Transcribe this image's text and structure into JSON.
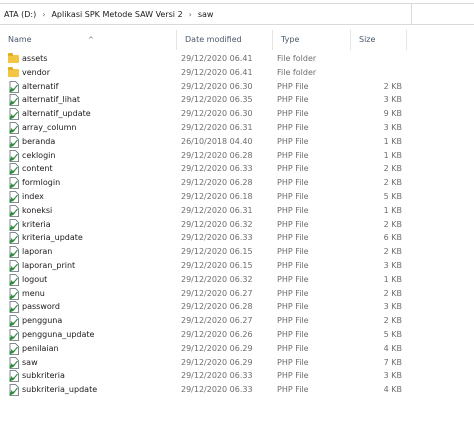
{
  "address": {
    "crumbs": [
      "ATA (D:)",
      "Aplikasi SPK Metode SAW Versi 2",
      "saw"
    ],
    "separator": "›"
  },
  "columns": {
    "name": "Name",
    "date": "Date modified",
    "type": "Type",
    "size": "Size",
    "sort_indicator": "^"
  },
  "colors": {
    "folder": "#f4c542",
    "php_icon_page": "#ffffff",
    "php_icon_accent": "#2e8b3d",
    "header_text": "#4a5a6a"
  },
  "files": [
    {
      "name": "assets",
      "date": "29/12/2020 06.41",
      "type": "File folder",
      "size": "",
      "icon": "folder-icon"
    },
    {
      "name": "vendor",
      "date": "29/12/2020 06.41",
      "type": "File folder",
      "size": "",
      "icon": "folder-icon"
    },
    {
      "name": "alternatif",
      "date": "29/12/2020 06.30",
      "type": "PHP File",
      "size": "2 KB",
      "icon": "php-file-icon"
    },
    {
      "name": "alternatif_lihat",
      "date": "29/12/2020 06.35",
      "type": "PHP File",
      "size": "3 KB",
      "icon": "php-file-icon"
    },
    {
      "name": "alternatif_update",
      "date": "29/12/2020 06.30",
      "type": "PHP File",
      "size": "9 KB",
      "icon": "php-file-icon"
    },
    {
      "name": "array_column",
      "date": "29/12/2020 06.31",
      "type": "PHP File",
      "size": "3 KB",
      "icon": "php-file-icon"
    },
    {
      "name": "beranda",
      "date": "26/10/2018 04.40",
      "type": "PHP File",
      "size": "1 KB",
      "icon": "php-file-icon"
    },
    {
      "name": "ceklogin",
      "date": "29/12/2020 06.28",
      "type": "PHP File",
      "size": "1 KB",
      "icon": "php-file-icon"
    },
    {
      "name": "content",
      "date": "29/12/2020 06.33",
      "type": "PHP File",
      "size": "2 KB",
      "icon": "php-file-icon"
    },
    {
      "name": "formlogin",
      "date": "29/12/2020 06.28",
      "type": "PHP File",
      "size": "2 KB",
      "icon": "php-file-icon"
    },
    {
      "name": "index",
      "date": "29/12/2020 06.18",
      "type": "PHP File",
      "size": "5 KB",
      "icon": "php-file-icon"
    },
    {
      "name": "koneksi",
      "date": "29/12/2020 06.31",
      "type": "PHP File",
      "size": "1 KB",
      "icon": "php-file-icon"
    },
    {
      "name": "kriteria",
      "date": "29/12/2020 06.32",
      "type": "PHP File",
      "size": "2 KB",
      "icon": "php-file-icon"
    },
    {
      "name": "kriteria_update",
      "date": "29/12/2020 06.33",
      "type": "PHP File",
      "size": "6 KB",
      "icon": "php-file-icon"
    },
    {
      "name": "laporan",
      "date": "29/12/2020 06.15",
      "type": "PHP File",
      "size": "2 KB",
      "icon": "php-file-icon"
    },
    {
      "name": "laporan_print",
      "date": "29/12/2020 06.15",
      "type": "PHP File",
      "size": "3 KB",
      "icon": "php-file-icon"
    },
    {
      "name": "logout",
      "date": "29/12/2020 06.32",
      "type": "PHP File",
      "size": "1 KB",
      "icon": "php-file-icon"
    },
    {
      "name": "menu",
      "date": "29/12/2020 06.27",
      "type": "PHP File",
      "size": "2 KB",
      "icon": "php-file-icon"
    },
    {
      "name": "password",
      "date": "29/12/2020 06.28",
      "type": "PHP File",
      "size": "3 KB",
      "icon": "php-file-icon"
    },
    {
      "name": "pengguna",
      "date": "29/12/2020 06.27",
      "type": "PHP File",
      "size": "2 KB",
      "icon": "php-file-icon"
    },
    {
      "name": "pengguna_update",
      "date": "29/12/2020 06.26",
      "type": "PHP File",
      "size": "5 KB",
      "icon": "php-file-icon"
    },
    {
      "name": "penilaian",
      "date": "29/12/2020 06.29",
      "type": "PHP File",
      "size": "4 KB",
      "icon": "php-file-icon"
    },
    {
      "name": "saw",
      "date": "29/12/2020 06.29",
      "type": "PHP File",
      "size": "7 KB",
      "icon": "php-file-icon"
    },
    {
      "name": "subkriteria",
      "date": "29/12/2020 06.33",
      "type": "PHP File",
      "size": "3 KB",
      "icon": "php-file-icon"
    },
    {
      "name": "subkriteria_update",
      "date": "29/12/2020 06.33",
      "type": "PHP File",
      "size": "4 KB",
      "icon": "php-file-icon"
    }
  ]
}
